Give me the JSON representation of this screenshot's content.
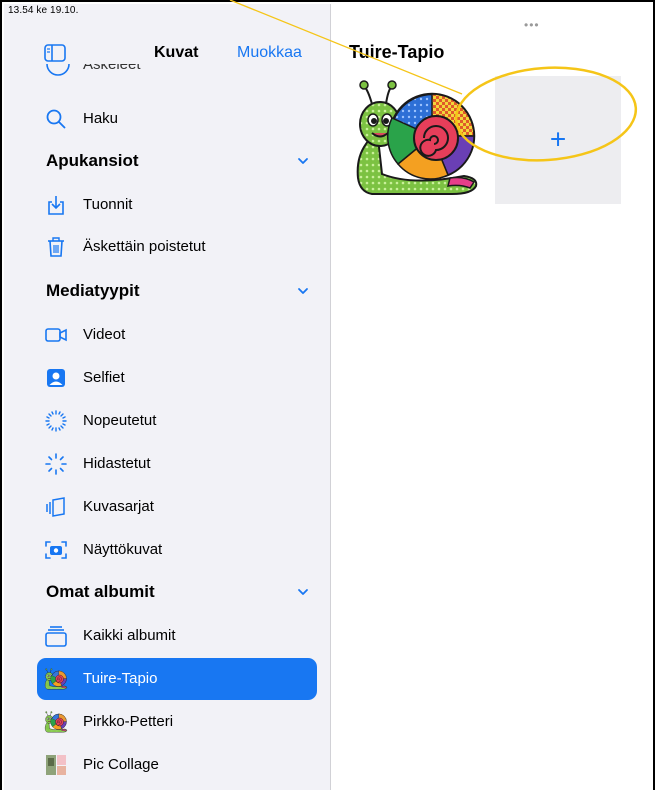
{
  "status_bar": {
    "time": "13.54  ke 19.10."
  },
  "sidebar": {
    "nav_title": "Kuvat",
    "edit_label": "Muokkaa",
    "partial_item": {
      "label": "Askeleet",
      "icon": "circle-icon"
    },
    "search_item": {
      "label": "Haku",
      "icon": "search-icon"
    },
    "sections": [
      {
        "title": "Apukansiot",
        "items": [
          {
            "label": "Tuonnit",
            "icon": "import-icon"
          },
          {
            "label": "Äskettäin poistetut",
            "icon": "trash-icon"
          }
        ]
      },
      {
        "title": "Mediatyypit",
        "items": [
          {
            "label": "Videot",
            "icon": "video-icon"
          },
          {
            "label": "Selfiet",
            "icon": "selfie-icon"
          },
          {
            "label": "Nopeutetut",
            "icon": "timelapse-icon"
          },
          {
            "label": "Hidastetut",
            "icon": "slowmo-icon"
          },
          {
            "label": "Kuvasarjat",
            "icon": "burst-icon"
          },
          {
            "label": "Näyttökuvat",
            "icon": "screenshot-icon"
          }
        ]
      },
      {
        "title": "Omat albumit",
        "items": [
          {
            "label": "Kaikki albumit",
            "icon": "albums-icon"
          },
          {
            "label": "Tuire-Tapio",
            "icon": "snail-thumbnail",
            "selected": true
          },
          {
            "label": "Pirkko-Petteri",
            "icon": "snail-thumbnail"
          },
          {
            "label": "Pic Collage",
            "icon": "collage-thumbnail"
          }
        ]
      }
    ]
  },
  "main": {
    "more_dots": "•••",
    "album_title": "Tuire-Tapio",
    "add_label": "+"
  },
  "colors": {
    "accent": "#1877f2",
    "sidebar_bg": "#f2f2f7",
    "annotation": "#f5c518"
  }
}
